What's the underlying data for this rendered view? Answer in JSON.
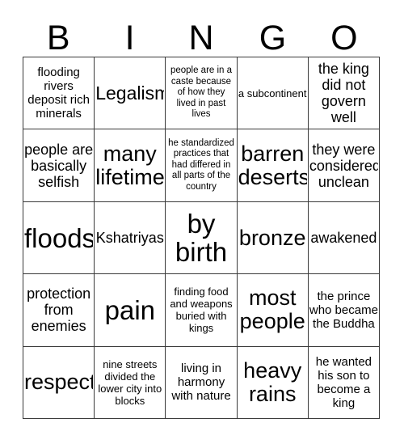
{
  "header": {
    "letters": [
      "B",
      "I",
      "N",
      "G",
      "O"
    ]
  },
  "grid": {
    "rows": [
      [
        {
          "text": "flooding rivers deposit rich minerals",
          "size": "fs-sm"
        },
        {
          "text": "Legalism",
          "size": "fs-lg nowrap"
        },
        {
          "text": "people are in a caste because of how they lived in past lives",
          "size": "fs-xxs"
        },
        {
          "text": "a subcontinent",
          "size": "fs-xs"
        },
        {
          "text": "the king did not govern well",
          "size": "fs-md"
        }
      ],
      [
        {
          "text": "people are basically selfish",
          "size": "fs-md"
        },
        {
          "text": "many lifetimes",
          "size": "fs-xl"
        },
        {
          "text": "he standardized practices that had differed in all parts of the country",
          "size": "fs-xxs clip"
        },
        {
          "text": "barren deserts",
          "size": "fs-xl"
        },
        {
          "text": "they were considered unclean",
          "size": "fs-md"
        }
      ],
      [
        {
          "text": "floods",
          "size": "fs-xxl nowrap"
        },
        {
          "text": "Kshatriyas",
          "size": "fs-md nowrap"
        },
        {
          "text": "by birth",
          "size": "fs-xxl"
        },
        {
          "text": "bronze",
          "size": "fs-xl nowrap"
        },
        {
          "text": "awakened",
          "size": "fs-md nowrap"
        }
      ],
      [
        {
          "text": "protection from enemies",
          "size": "fs-md"
        },
        {
          "text": "pain",
          "size": "fs-xxl nowrap"
        },
        {
          "text": "finding food and weapons buried with kings",
          "size": "fs-xs"
        },
        {
          "text": "most people",
          "size": "fs-xl"
        },
        {
          "text": "the prince who became the Buddha",
          "size": "fs-sm"
        }
      ],
      [
        {
          "text": "respect",
          "size": "fs-xl nowrap"
        },
        {
          "text": "nine streets divided the lower city into blocks",
          "size": "fs-xs"
        },
        {
          "text": "living in harmony with nature",
          "size": "fs-sm"
        },
        {
          "text": "heavy rains",
          "size": "fs-xl"
        },
        {
          "text": "he wanted his son to become a king",
          "size": "fs-sm"
        }
      ]
    ]
  },
  "colors": {
    "background": "#ffffff",
    "text": "#000000",
    "border": "#3a3a3a"
  }
}
